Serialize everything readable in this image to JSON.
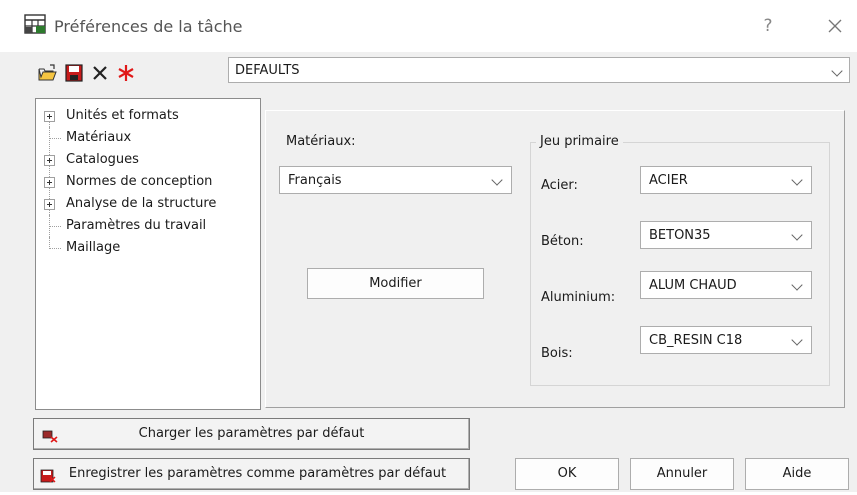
{
  "window": {
    "title": "Préférences de la tâche",
    "help_label": "?",
    "icons": [
      "task-preferences-icon",
      "help-icon",
      "close-icon"
    ]
  },
  "toolbar": {
    "icons": [
      "open-folder-icon",
      "save-icon",
      "delete-icon",
      "reset-star-icon"
    ]
  },
  "configuration": {
    "selected": "DEFAULTS"
  },
  "tree": {
    "items": [
      {
        "label": "Unités et formats",
        "expandable": true
      },
      {
        "label": "Matériaux",
        "expandable": false
      },
      {
        "label": "Catalogues",
        "expandable": true
      },
      {
        "label": "Normes de conception",
        "expandable": true
      },
      {
        "label": "Analyse de la structure",
        "expandable": true
      },
      {
        "label": "Paramètres du travail",
        "expandable": false
      },
      {
        "label": "Maillage",
        "expandable": false
      }
    ]
  },
  "materials": {
    "label": "Matériaux:",
    "database_selected": "Français",
    "modify_button": "Modifier",
    "group_title": "Jeu primaire",
    "rows": [
      {
        "label": "Acier:",
        "value": "ACIER"
      },
      {
        "label": "Béton:",
        "value": "BETON35"
      },
      {
        "label": "Aluminium:",
        "value": "ALUM CHAUD"
      },
      {
        "label": "Bois:",
        "value": "CB_RESIN C18"
      }
    ]
  },
  "footer": {
    "load_defaults": "Charger les paramètres par défaut",
    "save_defaults": "Enregistrer les paramètres comme paramètres par défaut",
    "ok": "OK",
    "cancel": "Annuler",
    "help": "Aide"
  },
  "colors": {
    "accent_red": "#d11f1f",
    "window_bg": "#f0f0f0"
  }
}
